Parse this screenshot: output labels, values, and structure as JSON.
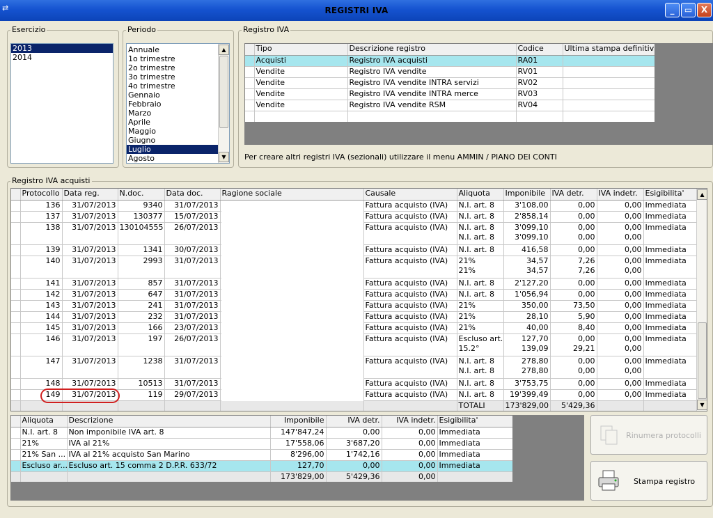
{
  "window": {
    "title": "REGISTRI IVA",
    "minimize": "_",
    "restore": "▭",
    "close": "X"
  },
  "esercizio": {
    "label": "Esercizio",
    "items": [
      "2013",
      "2014"
    ],
    "selected": "2013"
  },
  "periodo": {
    "label": "Periodo",
    "items": [
      "Annuale",
      "1o trimestre",
      "2o trimestre",
      "3o trimestre",
      "4o trimestre",
      "Gennaio",
      "Febbraio",
      "Marzo",
      "Aprile",
      "Maggio",
      "Giugno",
      "Luglio",
      "Agosto"
    ],
    "selected": "Luglio"
  },
  "registro": {
    "label": "Registro IVA",
    "columns": [
      "Tipo",
      "Descrizione registro",
      "Codice",
      "Ultima stampa definitiva"
    ],
    "rows": [
      [
        "Acquisti",
        "Registro IVA acquisti",
        "RA01",
        ""
      ],
      [
        "Vendite",
        "Registro IVA vendite",
        "RV01",
        ""
      ],
      [
        "Vendite",
        "Registro IVA vendite INTRA servizi",
        "RV02",
        ""
      ],
      [
        "Vendite",
        "Registro IVA vendite INTRA merce",
        "RV03",
        ""
      ],
      [
        "Vendite",
        "Registro IVA vendite RSM",
        "RV04",
        ""
      ]
    ],
    "note": "Per creare altri registri IVA (sezionali) utilizzare il menu AMMIN / PIANO DEI CONTI"
  },
  "acquisti": {
    "label": "Registro IVA acquisti",
    "columns": [
      "Protocollo",
      "Data reg.",
      "N.doc.",
      "Data doc.",
      "Ragione sociale",
      "Causale",
      "Aliquota",
      "Imponibile",
      "IVA detr.",
      "IVA indetr.",
      "Esigibilita'"
    ],
    "rows": [
      {
        "prot": "136",
        "datareg": "31/07/2013",
        "ndoc": "9340",
        "datadoc": "31/07/2013",
        "causale": "Fattura acquisto (IVA)",
        "lines": [
          [
            "N.I. art. 8",
            "3'108,00",
            "0,00",
            "0,00"
          ]
        ],
        "esig": "Immediata"
      },
      {
        "prot": "137",
        "datareg": "31/07/2013",
        "ndoc": "130377",
        "datadoc": "15/07/2013",
        "causale": "Fattura acquisto (IVA)",
        "lines": [
          [
            "N.I. art. 8",
            "2'858,14",
            "0,00",
            "0,00"
          ]
        ],
        "esig": "Immediata"
      },
      {
        "prot": "138",
        "datareg": "31/07/2013",
        "ndoc": "130104555",
        "datadoc": "26/07/2013",
        "causale": "Fattura acquisto (IVA)",
        "lines": [
          [
            "N.I. art. 8",
            "3'099,10",
            "0,00",
            "0,00"
          ],
          [
            "N.I. art. 8",
            "3'099,10",
            "0,00",
            "0,00"
          ]
        ],
        "esig": "Immediata"
      },
      {
        "prot": "139",
        "datareg": "31/07/2013",
        "ndoc": "1341",
        "datadoc": "30/07/2013",
        "causale": "Fattura acquisto (IVA)",
        "lines": [
          [
            "N.I. art. 8",
            "416,58",
            "0,00",
            "0,00"
          ]
        ],
        "esig": "Immediata"
      },
      {
        "prot": "140",
        "datareg": "31/07/2013",
        "ndoc": "2993",
        "datadoc": "31/07/2013",
        "causale": "Fattura acquisto (IVA)",
        "lines": [
          [
            "21%",
            "34,57",
            "7,26",
            "0,00"
          ],
          [
            "21%",
            "34,57",
            "7,26",
            "0,00"
          ]
        ],
        "esig": "Immediata"
      },
      {
        "prot": "141",
        "datareg": "31/07/2013",
        "ndoc": "857",
        "datadoc": "31/07/2013",
        "causale": "Fattura acquisto (IVA)",
        "lines": [
          [
            "N.I. art. 8",
            "2'127,20",
            "0,00",
            "0,00"
          ]
        ],
        "esig": "Immediata"
      },
      {
        "prot": "142",
        "datareg": "31/07/2013",
        "ndoc": "647",
        "datadoc": "31/07/2013",
        "causale": "Fattura acquisto (IVA)",
        "lines": [
          [
            "N.I. art. 8",
            "1'056,94",
            "0,00",
            "0,00"
          ]
        ],
        "esig": "Immediata"
      },
      {
        "prot": "143",
        "datareg": "31/07/2013",
        "ndoc": "241",
        "datadoc": "31/07/2013",
        "causale": "Fattura acquisto (IVA)",
        "lines": [
          [
            "21%",
            "350,00",
            "73,50",
            "0,00"
          ]
        ],
        "esig": "Immediata"
      },
      {
        "prot": "144",
        "datareg": "31/07/2013",
        "ndoc": "232",
        "datadoc": "31/07/2013",
        "causale": "Fattura acquisto (IVA)",
        "lines": [
          [
            "21%",
            "28,10",
            "5,90",
            "0,00"
          ]
        ],
        "esig": "Immediata"
      },
      {
        "prot": "145",
        "datareg": "31/07/2013",
        "ndoc": "166",
        "datadoc": "23/07/2013",
        "causale": "Fattura acquisto (IVA)",
        "lines": [
          [
            "21%",
            "40,00",
            "8,40",
            "0,00"
          ]
        ],
        "esig": "Immediata"
      },
      {
        "prot": "146",
        "datareg": "31/07/2013",
        "ndoc": "197",
        "datadoc": "26/07/2013",
        "causale": "Fattura acquisto (IVA)",
        "lines": [
          [
            "Escluso art.",
            "127,70",
            "0,00",
            "0,00"
          ],
          [
            "15.2°",
            "139,09",
            "29,21",
            "0,00"
          ]
        ],
        "esig": "Immediata"
      },
      {
        "prot": "147",
        "datareg": "31/07/2013",
        "ndoc": "1238",
        "datadoc": "31/07/2013",
        "causale": "Fattura acquisto (IVA)",
        "lines": [
          [
            "N.I. art. 8",
            "278,80",
            "0,00",
            "0,00"
          ],
          [
            "N.I. art. 8",
            "278,80",
            "0,00",
            "0,00"
          ]
        ],
        "esig": "Immediata"
      },
      {
        "prot": "148",
        "datareg": "31/07/2013",
        "ndoc": "10513",
        "datadoc": "31/07/2013",
        "causale": "Fattura acquisto (IVA)",
        "lines": [
          [
            "N.I. art. 8",
            "3'753,75",
            "0,00",
            "0,00"
          ]
        ],
        "esig": "Immediata"
      },
      {
        "prot": "149",
        "datareg": "31/07/2013",
        "ndoc": "119",
        "datadoc": "29/07/2013",
        "causale": "Fattura acquisto (IVA)",
        "lines": [
          [
            "N.I. art. 8",
            "19'399,49",
            "0,00",
            "0,00"
          ]
        ],
        "esig": "Immediata"
      }
    ],
    "totals": {
      "label": "TOTALI",
      "imponibile": "173'829,00",
      "ivadetr": "5'429,36"
    }
  },
  "riepilogo": {
    "columns": [
      "Aliquota",
      "Descrizione",
      "Imponibile",
      "IVA detr.",
      "IVA indetr.",
      "Esigibilita'"
    ],
    "rows": [
      [
        "N.I. art. 8",
        "Non imponibile IVA art. 8",
        "147'847,24",
        "0,00",
        "0,00",
        "Immediata"
      ],
      [
        "21%",
        "IVA al 21%",
        "17'558,06",
        "3'687,20",
        "0,00",
        "Immediata"
      ],
      [
        "21% San ...",
        "IVA al 21% acquisto San Marino",
        "8'296,00",
        "1'742,16",
        "0,00",
        "Immediata"
      ],
      [
        "Escluso ar...",
        "Escluso art. 15 comma 2 D.P.R. 633/72",
        "127,70",
        "0,00",
        "0,00",
        "Immediata"
      ]
    ],
    "totals": [
      "",
      "",
      "173'829,00",
      "5'429,36",
      "0,00",
      ""
    ]
  },
  "buttons": {
    "rinumera": "Rinumera protocolli",
    "stampa": "Stampa registro"
  }
}
